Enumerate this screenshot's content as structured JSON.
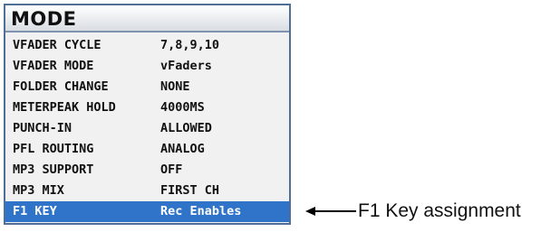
{
  "window": {
    "title": "MODE"
  },
  "menu": {
    "items": [
      {
        "key": "VFADER CYCLE",
        "value": "7,8,9,10"
      },
      {
        "key": "VFADER MODE",
        "value": "vFaders"
      },
      {
        "key": "FOLDER CHANGE",
        "value": "NONE"
      },
      {
        "key": "METERPEAK HOLD",
        "value": "4000MS"
      },
      {
        "key": "PUNCH-IN",
        "value": "ALLOWED"
      },
      {
        "key": "PFL ROUTING",
        "value": "ANALOG"
      },
      {
        "key": "MP3 SUPPORT",
        "value": "OFF"
      },
      {
        "key": "MP3 MIX",
        "value": "FIRST CH"
      },
      {
        "key": "F1 KEY",
        "value": "Rec Enables"
      }
    ],
    "selected_index": 8
  },
  "annotation": {
    "text": "F1 Key assignment"
  },
  "colors": {
    "selection": "#2f74c9",
    "border": "#4f6f97",
    "panel_bg": "#f1f1f1"
  }
}
